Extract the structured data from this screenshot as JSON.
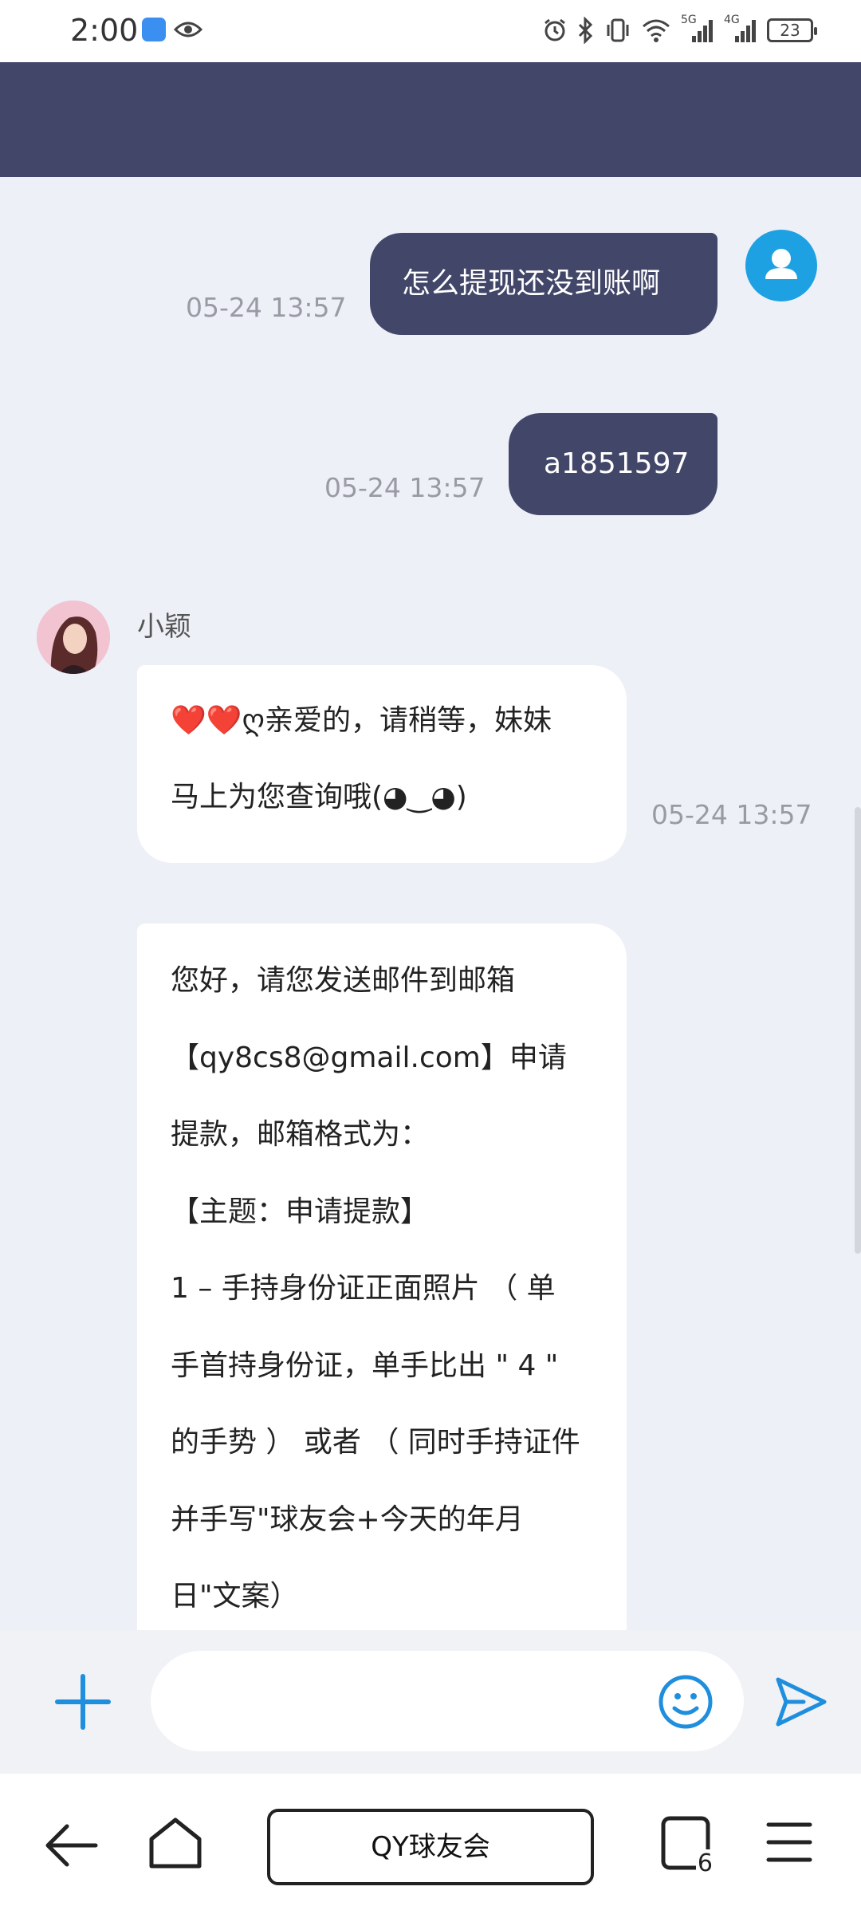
{
  "status_bar": {
    "time": "2:00",
    "icons": [
      "cloud-app-icon",
      "eye-icon",
      "alarm-icon",
      "bluetooth-icon",
      "vibrate-icon",
      "wifi-icon",
      "signal-5g-icon",
      "signal-4g-icon"
    ],
    "network_5g": "5G",
    "network_4g": "4G",
    "battery": "23"
  },
  "colors": {
    "header": "#424669",
    "outgoing_bubble": "#424669",
    "incoming_bubble": "#ffffff",
    "chat_background": "#eef0f8",
    "accent": "#1da1e2",
    "heart": "#d9162b"
  },
  "messages": [
    {
      "direction": "out",
      "text": "怎么提现还没到账啊",
      "time": "05-24 13:57"
    },
    {
      "direction": "out",
      "text": "a1851597",
      "time": "05-24 13:57"
    },
    {
      "direction": "in",
      "sender": "小颖",
      "text_hearts": "❤️❤️",
      "text_lines": [
        "ღ亲爱的，请稍等，妹妹",
        "马上为您查询哦(◕‿◕)"
      ],
      "time": "05-24 13:57"
    },
    {
      "direction": "in",
      "text_lines": [
        "您好，请您发送邮件到邮箱",
        "【qy8cs8@gmail.com】申请",
        "提款，邮箱格式为：",
        "【主题：申请提款】",
        "1 – 手持身份证正面照片 （ 单",
        "手首持身份证，单手比出 \" 4 \"",
        "的手势 ） 或者 （ 同时手持证件",
        "并手写\"球友会+今天的年月",
        "日\"文案）"
      ]
    }
  ],
  "input_bar": {
    "placeholder": "",
    "value": ""
  },
  "browser_nav": {
    "url_label": "QY球友会",
    "tab_count": "6"
  }
}
